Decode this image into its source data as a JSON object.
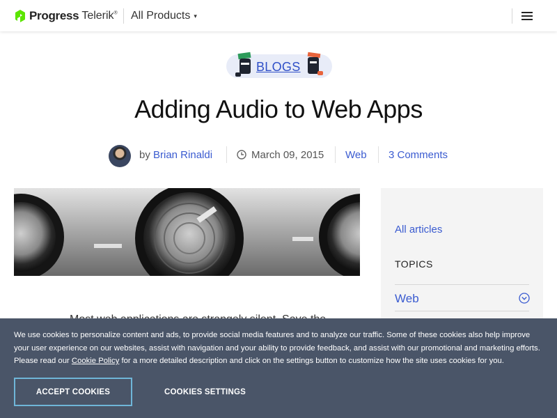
{
  "header": {
    "logo_progress": "Progress",
    "logo_telerik": "Telerik",
    "logo_reg": "®",
    "products_label": "All Products",
    "caret": "▾"
  },
  "badge": {
    "label": "BLOGS"
  },
  "article": {
    "title": "Adding Audio to Web Apps",
    "by": "by",
    "author": "Brian Rinaldi",
    "date": "March 09, 2015",
    "tag": "Web",
    "comments": "3 Comments",
    "body_peek": "Most web applications are strangely silent. Save the"
  },
  "sidebar": {
    "all_articles": "All articles",
    "topics_heading": "TOPICS",
    "topic_web": "Web"
  },
  "cookie": {
    "text_before_link": "We use cookies to personalize content and ads, to provide social media features and to analyze our traffic. Some of these cookies also help improve your user experience on our websites, assist with navigation and your ability to provide feedback, and assist with our promotional and marketing efforts. Please read our ",
    "link": "Cookie Policy",
    "text_after_link": " for a more detailed description and click on the settings button to customize how the site uses cookies for you.",
    "accept_label": "ACCEPT COOKIES",
    "settings_label": "COOKIES SETTINGS"
  },
  "colors": {
    "brand_green": "#5ce500",
    "link_blue": "#3a5bd0",
    "cookie_bg": "#4a5568",
    "accept_border": "#6fb6d8",
    "badge_bg": "#e8ecf8"
  },
  "icons": {
    "logo": "progress-logo-icon",
    "menu": "hamburger-menu-icon",
    "date": "clock-icon",
    "expand": "chevron-down-circle-icon"
  }
}
